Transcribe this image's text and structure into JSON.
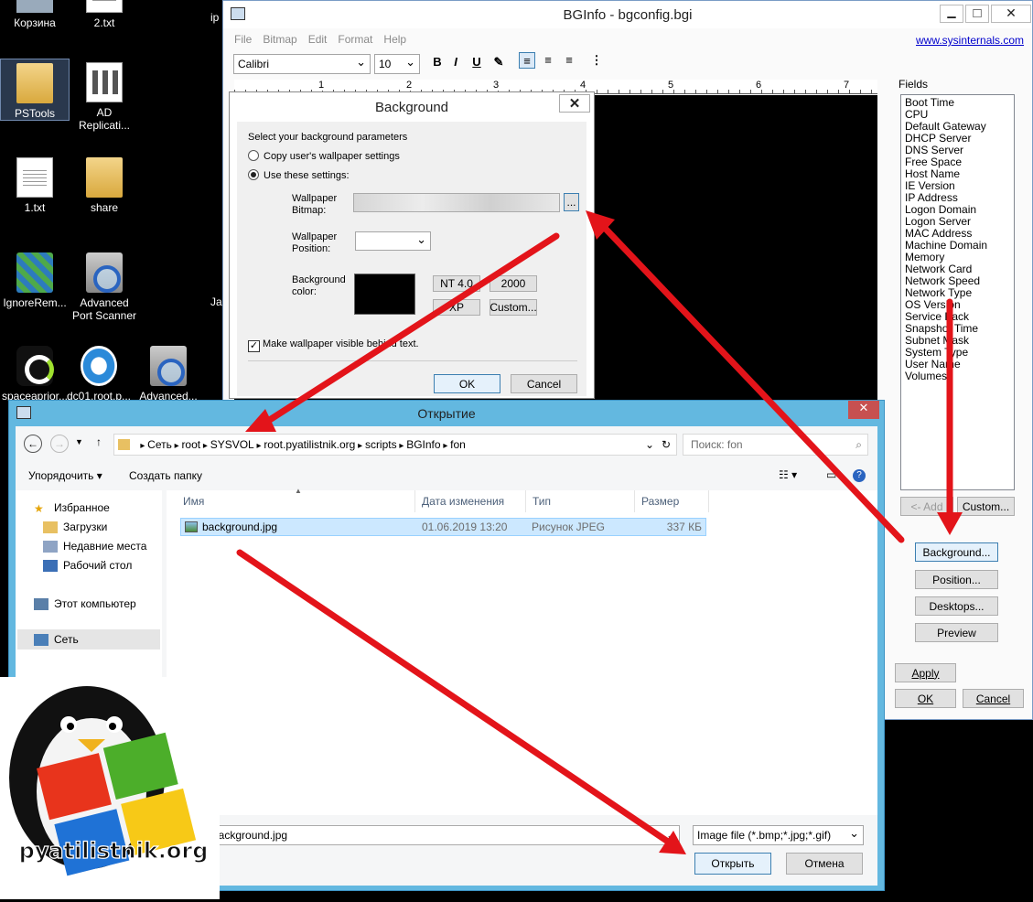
{
  "desktop": {
    "icons": [
      {
        "label": "Корзина"
      },
      {
        "label": "2.txt"
      },
      {
        "label": "PSTools"
      },
      {
        "label": "AD Replicati..."
      },
      {
        "label": "1.txt"
      },
      {
        "label": "share"
      },
      {
        "label": "IgnoreRem..."
      },
      {
        "label": "Advanced Port Scanner"
      },
      {
        "label": "spaceaprior..."
      },
      {
        "label": "dc01.root.p..."
      },
      {
        "label": "Advanced..."
      }
    ],
    "edge_labels": [
      "ip",
      "Ja"
    ]
  },
  "bginfo": {
    "title": "BGInfo - bgconfig.bgi",
    "menu": [
      "File",
      "Bitmap",
      "Edit",
      "Format",
      "Help"
    ],
    "link": "www.sysinternals.com",
    "font": "Calibri",
    "size": "10",
    "bold": "B",
    "italic": "I",
    "underline": "U",
    "ruler": [
      "1",
      "2",
      "3",
      "4",
      "5",
      "6",
      "7"
    ],
    "fields_label": "Fields",
    "fields": [
      "Boot Time",
      "CPU",
      "Default Gateway",
      "DHCP Server",
      "DNS Server",
      "Free Space",
      "Host Name",
      "IE Version",
      "IP Address",
      "Logon Domain",
      "Logon Server",
      "MAC Address",
      "Machine Domain",
      "Memory",
      "Network Card",
      "Network Speed",
      "Network Type",
      "OS Version",
      "Service Pack",
      "Snapshot Time",
      "Subnet Mask",
      "System Type",
      "User Name",
      "Volumes"
    ],
    "add": "<- Add",
    "custom": "Custom...",
    "background": "Background...",
    "position": "Position...",
    "desktops": "Desktops...",
    "preview": "Preview",
    "apply": "Apply",
    "ok": "OK",
    "cancel": "Cancel"
  },
  "bgdialog": {
    "title": "Background",
    "intro": "Select your background parameters",
    "opt1": "Copy user's wallpaper settings",
    "opt2": "Use these settings:",
    "wallpaper_bitmap": "Wallpaper Bitmap:",
    "browse": "...",
    "wallpaper_position": "Wallpaper Position:",
    "bg_color": "Background color:",
    "nt4": "NT 4.0",
    "w2000": "2000",
    "xp": "XP",
    "custom": "Custom...",
    "make_visible": "Make wallpaper visible behind text.",
    "ok": "OK",
    "cancel": "Cancel"
  },
  "open": {
    "title": "Открытие",
    "path": [
      "Сеть",
      "root",
      "SYSVOL",
      "root.pyatilistnik.org",
      "scripts",
      "BGInfo",
      "fon"
    ],
    "search_placeholder": "Поиск: fon",
    "organize": "Упорядочить",
    "new_folder": "Создать папку",
    "nav": {
      "favorites": "Избранное",
      "downloads": "Загрузки",
      "recent": "Недавние места",
      "desktop": "Рабочий стол",
      "computer": "Этот компьютер",
      "network": "Сеть"
    },
    "columns": [
      "Имя",
      "Дата изменения",
      "Тип",
      "Размер"
    ],
    "file": {
      "name": "background.jpg",
      "date": "01.06.2019 13:20",
      "type": "Рисунок JPEG",
      "size": "337 КБ"
    },
    "filename": "background.jpg",
    "filter": "Image file (*.bmp;*.jpg;*.gif)",
    "open_btn": "Открыть",
    "cancel_btn": "Отмена"
  },
  "watermark": "pyatilistnik.org",
  "colors": {
    "arrow": "#e3141a",
    "titlebar": "#63b8e0",
    "close": "#c75050"
  }
}
